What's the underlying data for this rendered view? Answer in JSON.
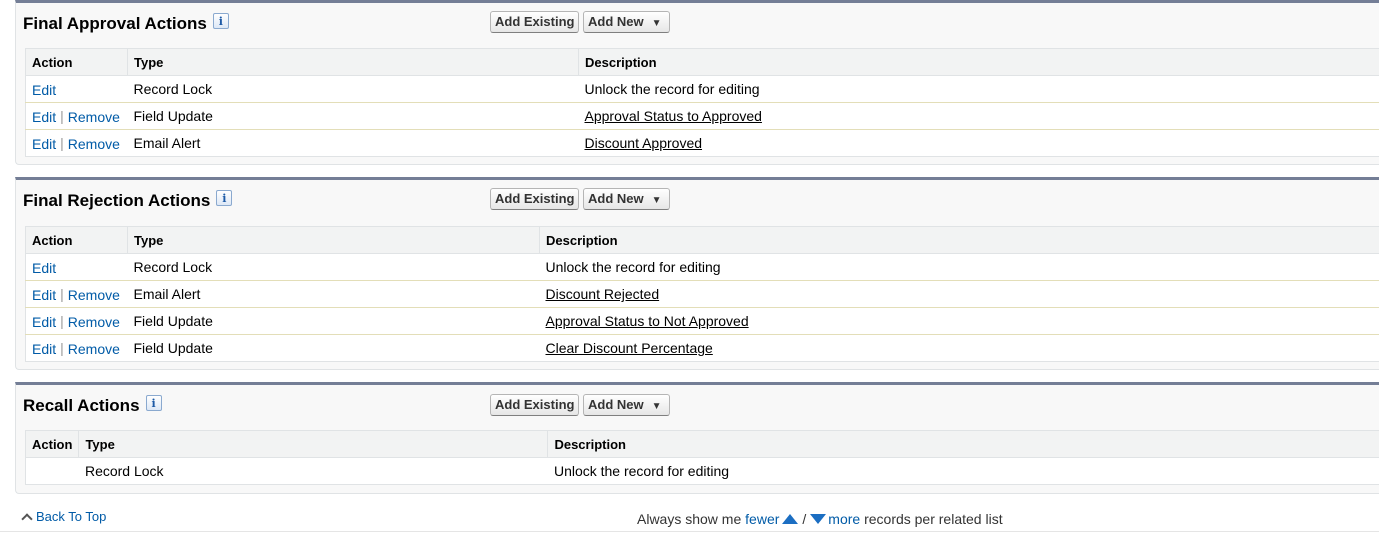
{
  "final_approval": {
    "title": "Final Approval Actions",
    "info_icon": "i",
    "add_existing": "Add Existing",
    "add_new": "Add New",
    "columns": [
      "Action",
      "Type",
      "Description"
    ],
    "rows": [
      {
        "edit": "Edit",
        "remove": "",
        "type": "Record Lock",
        "description": "Unlock the record for editing"
      },
      {
        "edit": "Edit",
        "remove": "Remove",
        "type": "Field Update",
        "description": "Approval Status to Approved"
      },
      {
        "edit": "Edit",
        "remove": "Remove",
        "type": "Email Alert",
        "description": "Discount Approved"
      }
    ]
  },
  "final_rejection": {
    "title": "Final Rejection Actions",
    "info_icon": "i",
    "add_existing": "Add Existing",
    "add_new": "Add New",
    "columns": [
      "Action",
      "Type",
      "Description"
    ],
    "rows": [
      {
        "edit": "Edit",
        "remove": "",
        "type": "Record Lock",
        "description": "Unlock the record for editing"
      },
      {
        "edit": "Edit",
        "remove": "Remove",
        "type": "Email Alert",
        "description": "Discount Rejected"
      },
      {
        "edit": "Edit",
        "remove": "Remove",
        "type": "Field Update",
        "description": "Approval Status to Not Approved"
      },
      {
        "edit": "Edit",
        "remove": "Remove",
        "type": "Field Update",
        "description": "Clear Discount Percentage"
      }
    ]
  },
  "recall": {
    "title": "Recall Actions",
    "info_icon": "i",
    "add_existing": "Add Existing",
    "add_new": "Add New",
    "columns": [
      "Action",
      "Type",
      "Description"
    ],
    "rows": [
      {
        "type": "Record Lock",
        "description": "Unlock the record for editing"
      }
    ]
  },
  "footer": {
    "back_to_top": "Back To Top",
    "always_show_me": "Always show me",
    "fewer": "fewer",
    "slash": "/",
    "more": "more",
    "records_per_list": "records per related list"
  },
  "colors": {
    "link": "#015ba7",
    "section_border": "#747e96",
    "arrow": "#1b6ec2"
  }
}
